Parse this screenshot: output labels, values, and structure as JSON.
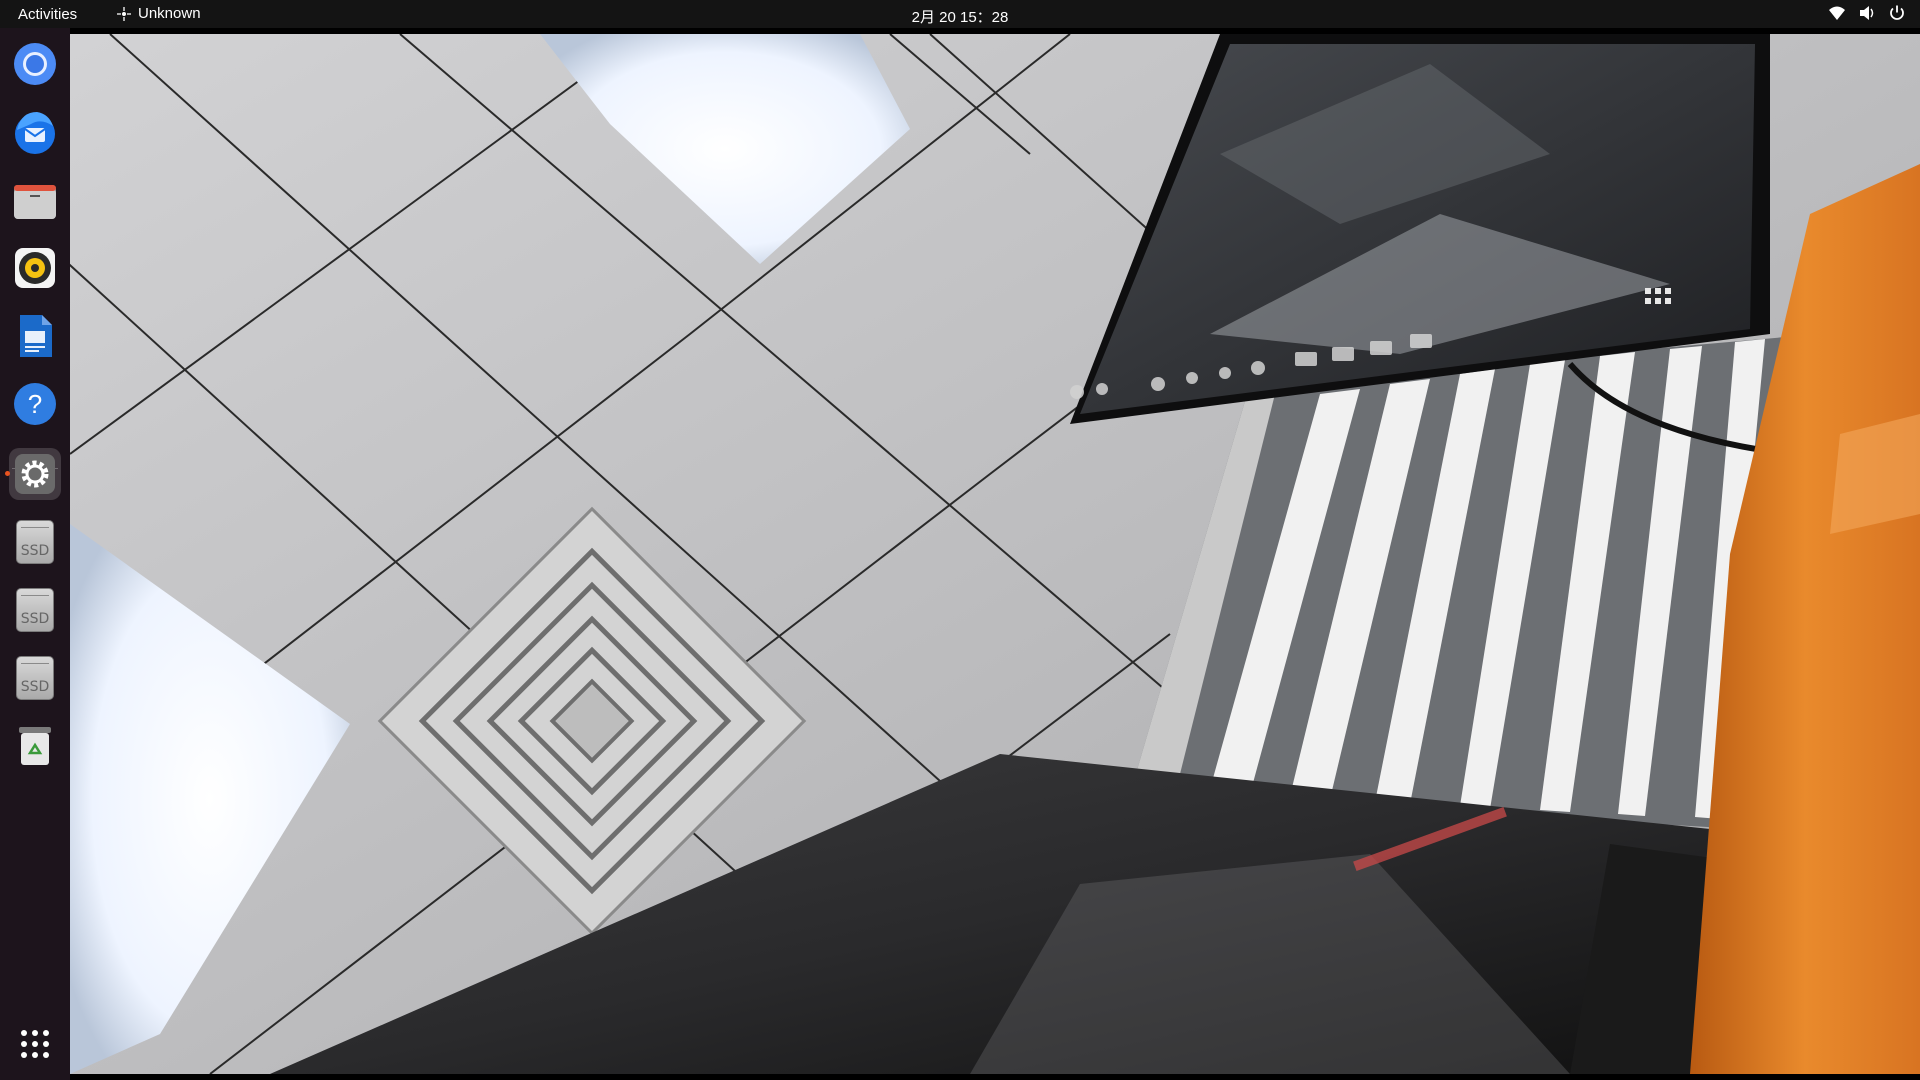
{
  "topbar": {
    "activities_label": "Activities",
    "app_indicator_label": "Unknown",
    "clock": "2月 20  15：28",
    "tray_icons": [
      "network-wifi-icon",
      "volume-icon",
      "power-icon"
    ]
  },
  "dock": {
    "items": [
      {
        "name": "chromium-browser",
        "icon": "chromium-icon"
      },
      {
        "name": "thunderbird-mail",
        "icon": "thunderbird-icon"
      },
      {
        "name": "files",
        "icon": "files-folder-icon"
      },
      {
        "name": "rhythmbox",
        "icon": "rhythmbox-icon"
      },
      {
        "name": "libreoffice-writer",
        "icon": "writer-icon"
      },
      {
        "name": "help",
        "icon": "help-icon"
      },
      {
        "name": "settings",
        "icon": "settings-gear-icon",
        "active": true
      },
      {
        "name": "ssd-drive-1",
        "icon": "ssd-drive-icon",
        "label": "SSD"
      },
      {
        "name": "ssd-drive-2",
        "icon": "ssd-drive-icon",
        "label": "SSD"
      },
      {
        "name": "ssd-drive-3",
        "icon": "ssd-drive-icon",
        "label": "SSD"
      },
      {
        "name": "trash",
        "icon": "trash-icon"
      }
    ],
    "show_apps_icon": "app-grid-icon"
  },
  "colors": {
    "topbar_bg": "#141414",
    "dock_bg": "#1d141c",
    "accent": "#e95420"
  }
}
